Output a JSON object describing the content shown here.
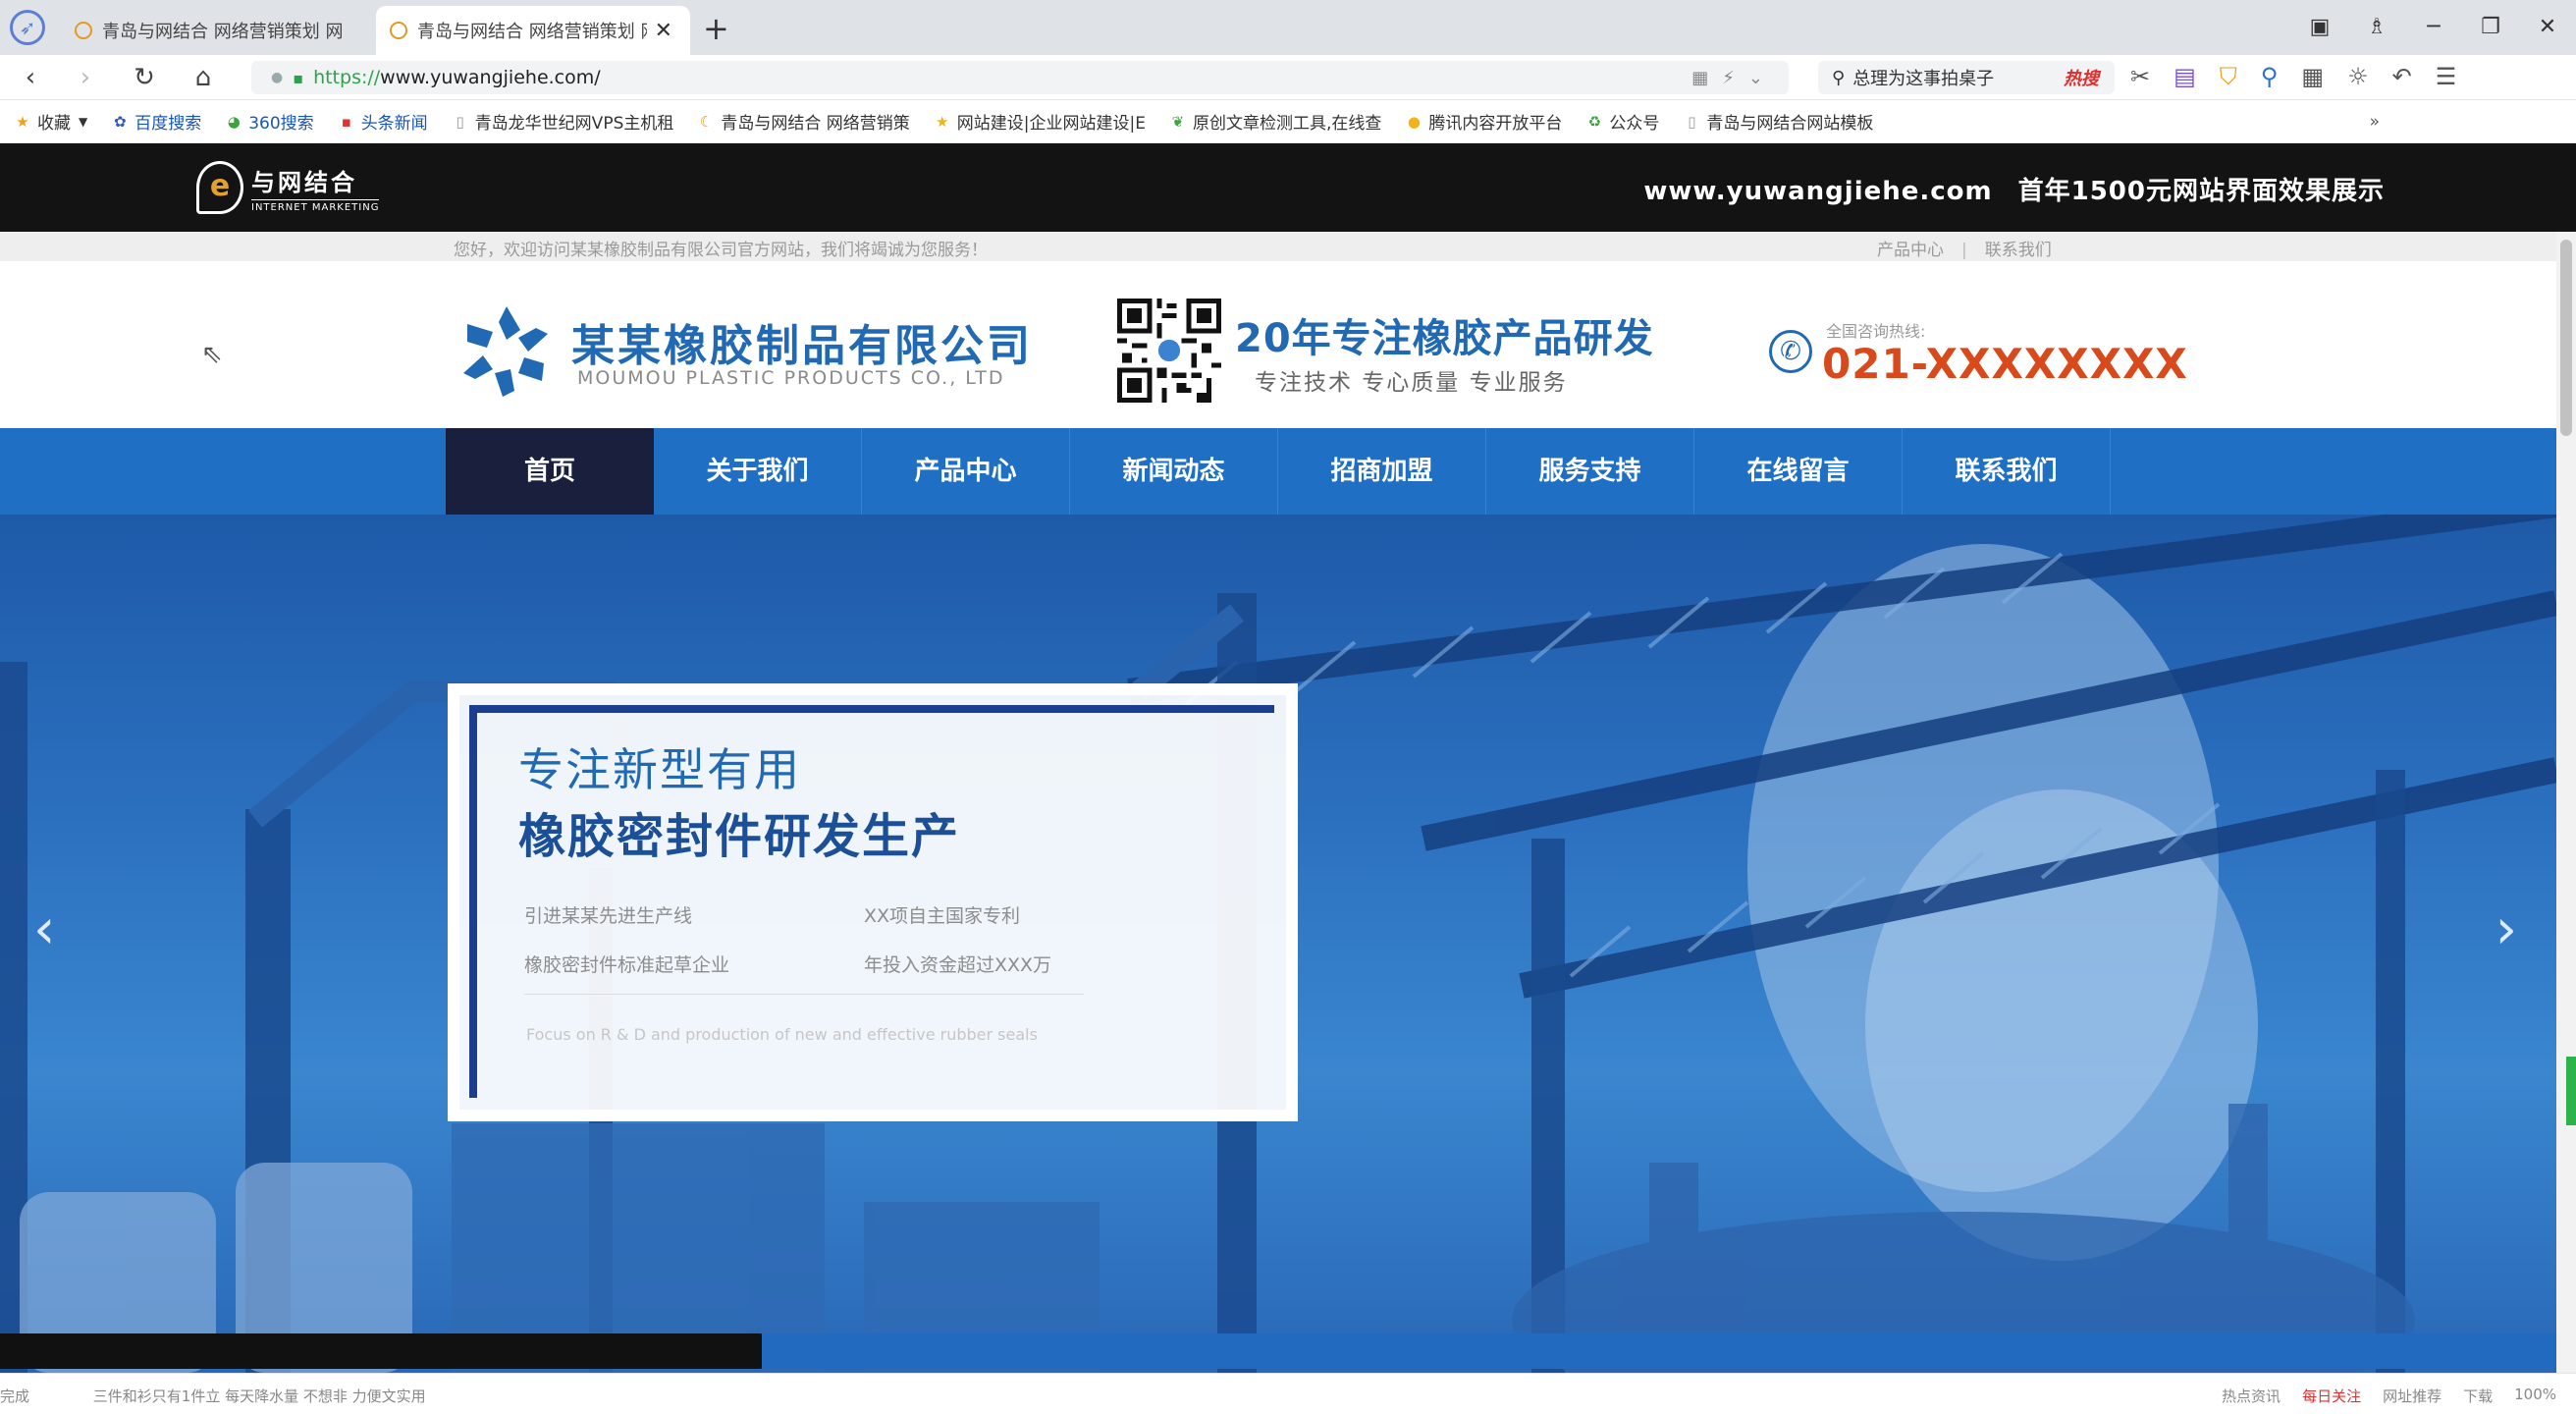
{
  "browser": {
    "tabs": [
      {
        "title": "青岛与网结合 网络营销策划 网",
        "active": false
      },
      {
        "title": "青岛与网结合 网络营销策划 网",
        "active": true
      }
    ],
    "url_scheme": "https://",
    "url_host": "www.yuwangjiehe.com/",
    "search_text": "总理为这事拍桌子",
    "search_hot": "热搜",
    "bookmarks": [
      {
        "label": "收藏",
        "icon": "star-icon"
      },
      {
        "label": "百度搜索",
        "icon": "baidu-icon"
      },
      {
        "label": "360搜索",
        "icon": "360-icon"
      },
      {
        "label": "头条新闻",
        "icon": "news-icon"
      },
      {
        "label": "青岛龙华世纪网VPS主机租",
        "icon": "page-icon"
      },
      {
        "label": "青岛与网结合 网络营销策",
        "icon": "site-icon"
      },
      {
        "label": "网站建设|企业网站建设|E",
        "icon": "star-icon"
      },
      {
        "label": "原创文章检测工具,在线查",
        "icon": "leaf-icon"
      },
      {
        "label": "腾讯内容开放平台",
        "icon": "bell-icon"
      },
      {
        "label": "公众号",
        "icon": "recycle-icon"
      },
      {
        "label": "青岛与网结合网站模板",
        "icon": "page-icon"
      }
    ],
    "bookmarks_more": "»"
  },
  "banner": {
    "brand_cn": "与网结合",
    "brand_en": "INTERNET MARKETING",
    "domain": "www.yuwangjiehe.com",
    "tagline": "首年1500元网站界面效果展示"
  },
  "site": {
    "welcome": "您好，欢迎访问某某橡胶制品有限公司官方网站，我们将竭诚为您服务！",
    "top_links": [
      "产品中心",
      "联系我们"
    ],
    "company_name": "某某橡胶制品有限公司",
    "company_en": "MOUMOU PLASTIC PRODUCTS CO., LTD",
    "slogan_main": "20年专注橡胶产品研发",
    "slogan_sub": "专注技术 专心质量 专业服务",
    "hotline_label": "全国咨询热线:",
    "hotline": "021-XXXXXXXX",
    "nav": [
      {
        "label": "首页",
        "active": true
      },
      {
        "label": "关于我们",
        "active": false
      },
      {
        "label": "产品中心",
        "active": false
      },
      {
        "label": "新闻动态",
        "active": false
      },
      {
        "label": "招商加盟",
        "active": false
      },
      {
        "label": "服务支持",
        "active": false
      },
      {
        "label": "在线留言",
        "active": false
      },
      {
        "label": "联系我们",
        "active": false
      }
    ],
    "hero": {
      "line1": "专注新型有用",
      "line2": "橡胶密封件研发生产",
      "points": [
        "引进某某先进生产线",
        "XX项自主国家专利",
        "橡胶密封件标准起草企业",
        "年投入资金超过XXX万"
      ],
      "en": "Focus on R & D and production of new and effective rubber seals",
      "prev": "‹",
      "next": "›",
      "slide_progress": 0.298
    }
  },
  "statusbar": {
    "left_label": "完成",
    "left_msg": "三件和衫只有1件立 每天降水量 不想非 力便文实用",
    "right_items": [
      "热点资讯",
      "每日关注",
      "网址推荐",
      "下载",
      "100%"
    ]
  },
  "colors": {
    "site_blue": "#1f6fc4",
    "nav_active": "#1a1f3d",
    "hotline": "#d84a1b",
    "title_blue": "#2169b3"
  }
}
